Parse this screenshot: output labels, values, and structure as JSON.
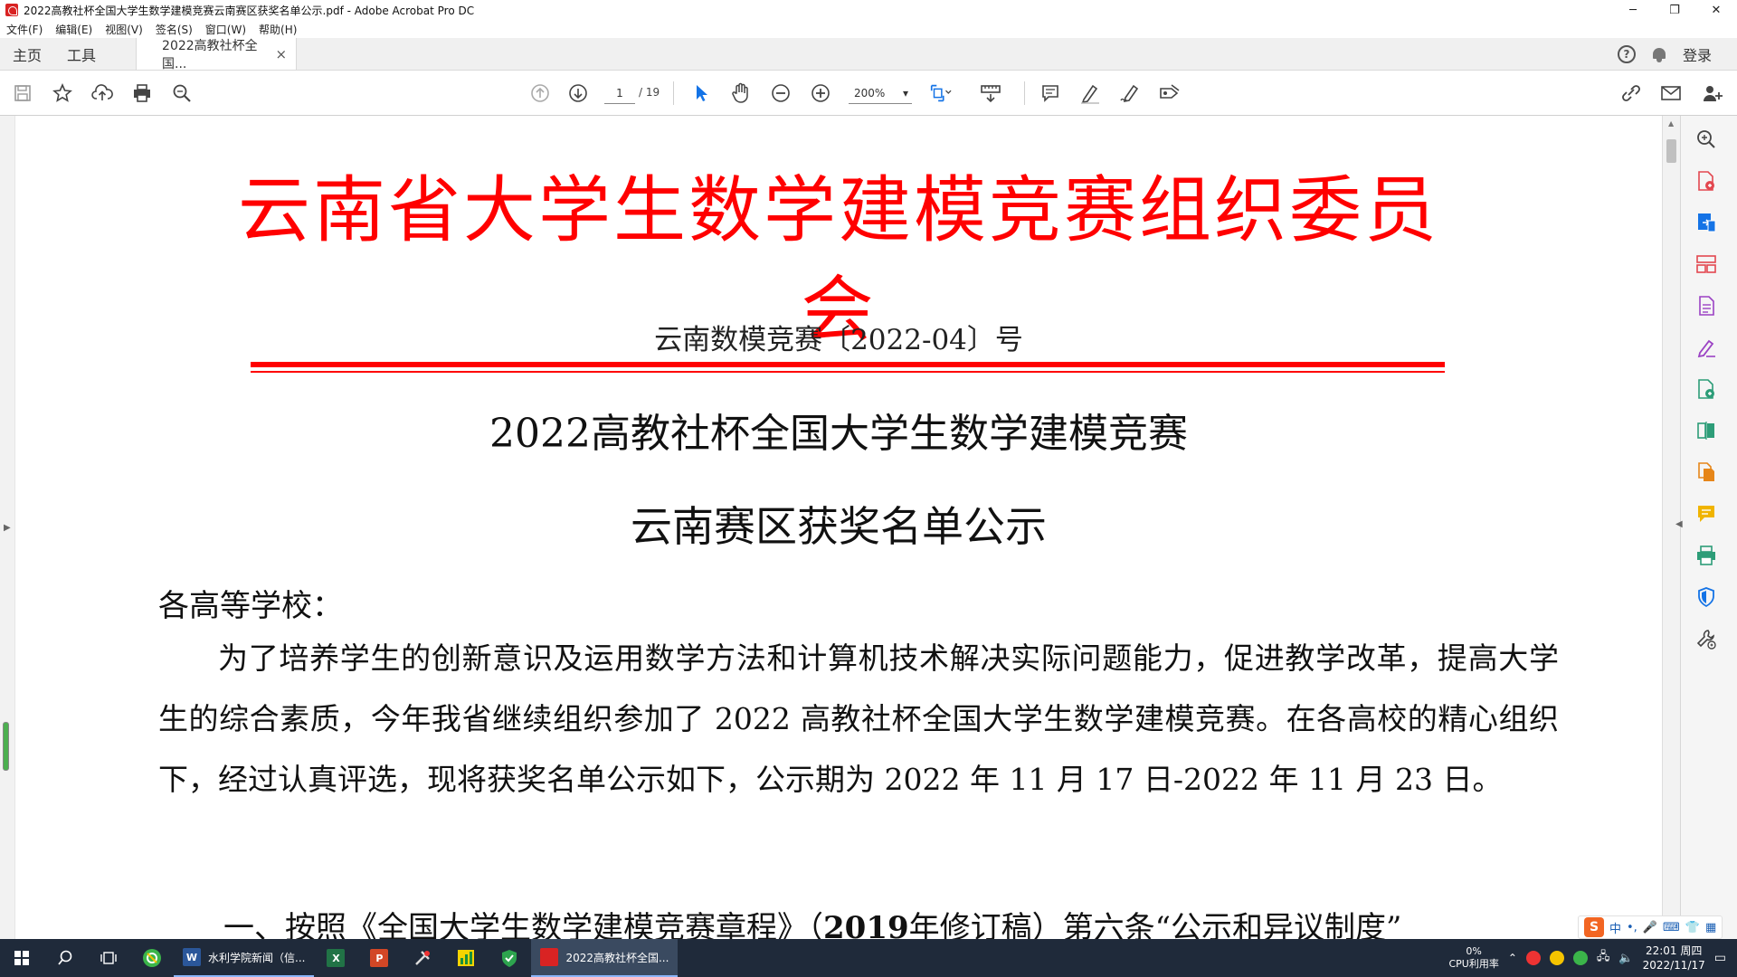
{
  "window": {
    "title": "2022高教社杯全国大学生数学建模竞赛云南赛区获奖名单公示.pdf - Adobe Acrobat Pro DC",
    "minimize": "─",
    "maximize": "❐",
    "close": "✕"
  },
  "menu": [
    "文件(F)",
    "编辑(E)",
    "视图(V)",
    "签名(S)",
    "窗口(W)",
    "帮助(H)"
  ],
  "tabs": {
    "home": "主页",
    "tools": "工具",
    "document": "2022高教社杯全国...",
    "close": "×",
    "help": "?",
    "login": "登录"
  },
  "toolbar": {
    "page_current": "1",
    "page_total": "/ 19",
    "zoom": "200%",
    "zoom_caret": "▾"
  },
  "document": {
    "org_header": "云南省大学生数学建模竞赛组织委员会",
    "doc_number": "云南数模竞赛〔2022-04〕号",
    "title_line1": "2022高教社杯全国大学生数学建模竞赛",
    "title_line2": "云南赛区获奖名单公示",
    "salutation": "各高等学校：",
    "body": "为了培养学生的创新意识及运用数学方法和计算机技术解决实际问题能力，促进教学改革，提高大学生的综合素质，今年我省继续组织参加了 2022 高教社杯全国大学生数学建模竞赛。在各高校的精心组织下，经过认真评选，现将获奖名单公示如下，公示期为 2022 年 11 月 17 日-2022 年 11 月 23 日。",
    "section1_a": "一、按照《全国大学生数学建模竞赛章程》（",
    "section1_b": "2019",
    "section1_c": "年修订稿）第六条“公示和异议制度”"
  },
  "ime": {
    "logo": "S",
    "mode": "中",
    "punct": "•,",
    "voice": "🎤",
    "keyboard": "⌨",
    "skin": "👕",
    "tools": "▦"
  },
  "taskbar": {
    "word_task": "水利学院新闻（信...",
    "acrobat_task": "2022高教社杯全国...",
    "cpu_value": "0%",
    "cpu_label": "CPU利用率",
    "time": "22:01 周四",
    "date": "2022/11/17",
    "word_icon": "W",
    "excel_icon": "X",
    "ppt_icon": "P"
  },
  "colors": {
    "header_red": "#ff0000",
    "taskbar": "#1f2a3a",
    "accent_blue": "#1473e6"
  }
}
